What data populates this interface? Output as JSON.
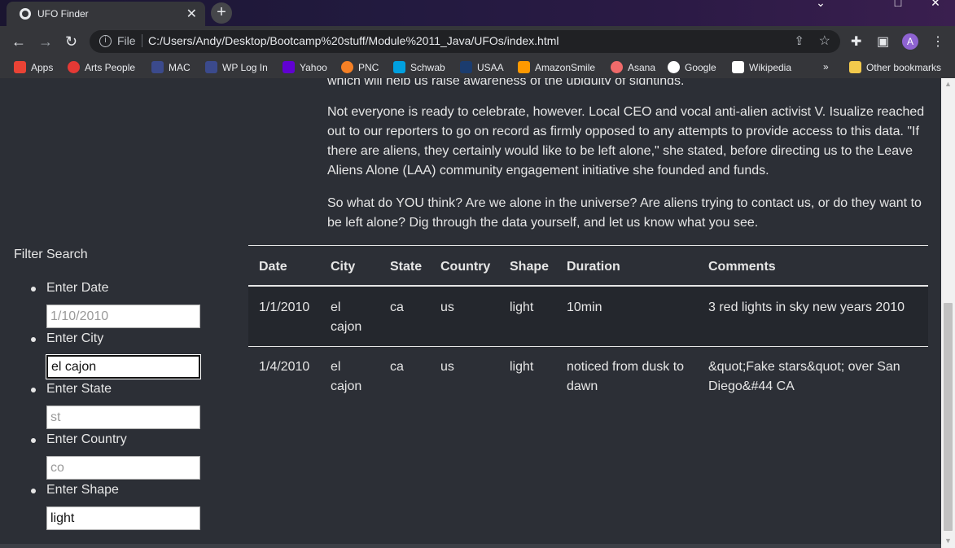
{
  "browser": {
    "tab_title": "UFO Finder",
    "tab_close": "✕",
    "new_tab": "+",
    "url_scheme": "File",
    "url": "C:/Users/Andy/Desktop/Bootcamp%20stuff/Module%2011_Java/UFOs/index.html",
    "avatar_letter": "A",
    "bookmarks": [
      {
        "label": "Apps",
        "color": "#ea4335"
      },
      {
        "label": "Arts People",
        "color": "#e53935"
      },
      {
        "label": "MAC",
        "color": "#3b4a8c"
      },
      {
        "label": "WP Log In",
        "color": "#3b4a8c"
      },
      {
        "label": "Yahoo",
        "color": "#6001d2"
      },
      {
        "label": "PNC",
        "color": "#f58025"
      },
      {
        "label": "Schwab",
        "color": "#00a0df"
      },
      {
        "label": "USAA",
        "color": "#1b3c6e"
      },
      {
        "label": "AmazonSmile",
        "color": "#ff9900"
      },
      {
        "label": "Asana",
        "color": "#f06a6a"
      },
      {
        "label": "Google",
        "color": "#ffffff"
      },
      {
        "label": "Wikipedia",
        "color": "#ffffff"
      }
    ],
    "bookmarks_overflow": "»",
    "other_bookmarks": "Other bookmarks"
  },
  "article": {
    "partial_line": "which will help us raise awareness of the ubiquity of sightings.",
    "para2": "Not everyone is ready to celebrate, however. Local CEO and vocal anti-alien activist V. Isualize reached out to our reporters to go on record as firmly opposed to any attempts to provide access to this data. \"If there are aliens, they certainly would like to be left alone,\" she stated, before directing us to the Leave Aliens Alone (LAA) community engagement initiative she founded and funds.",
    "para3": "So what do YOU think? Are we alone in the universe? Are aliens trying to contact us, or do they want to be left alone? Dig through the data yourself, and let us know what you see."
  },
  "filters": {
    "title": "Filter Search",
    "date": {
      "label": "Enter Date",
      "placeholder": "1/10/2010",
      "value": ""
    },
    "city": {
      "label": "Enter City",
      "placeholder": "",
      "value": "el cajon"
    },
    "state": {
      "label": "Enter State",
      "placeholder": "st",
      "value": ""
    },
    "country": {
      "label": "Enter Country",
      "placeholder": "co",
      "value": ""
    },
    "shape": {
      "label": "Enter Shape",
      "placeholder": "",
      "value": "light"
    }
  },
  "table": {
    "headers": [
      "Date",
      "City",
      "State",
      "Country",
      "Shape",
      "Duration",
      "Comments"
    ],
    "rows": [
      {
        "date": "1/1/2010",
        "city_line1": "el",
        "city_line2": "cajon",
        "state": "ca",
        "country": "us",
        "shape": "light",
        "duration_line1": "10min",
        "duration_line2": "",
        "comments_line1": "3 red lights in sky new years 2010",
        "comments_line2": ""
      },
      {
        "date": "1/4/2010",
        "city_line1": "el",
        "city_line2": "cajon",
        "state": "ca",
        "country": "us",
        "shape": "light",
        "duration_line1": "noticed from dusk to",
        "duration_line2": "dawn",
        "comments_line1": "&quot;Fake stars&quot; over San",
        "comments_line2": "Diego&#44 CA"
      }
    ]
  }
}
